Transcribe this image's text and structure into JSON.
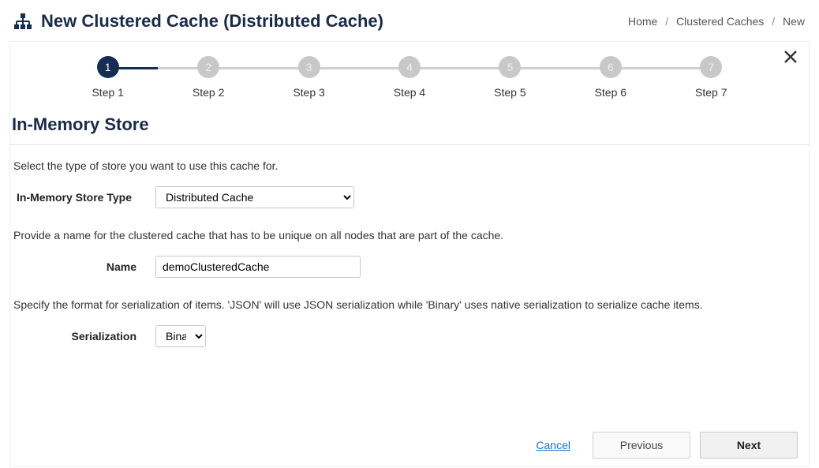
{
  "header": {
    "title": "New Clustered Cache (Distributed Cache)"
  },
  "breadcrumb": {
    "home": "Home",
    "caches": "Clustered Caches",
    "current": "New"
  },
  "stepper": {
    "steps": [
      {
        "num": "1",
        "label": "Step 1"
      },
      {
        "num": "2",
        "label": "Step 2"
      },
      {
        "num": "3",
        "label": "Step 3"
      },
      {
        "num": "4",
        "label": "Step 4"
      },
      {
        "num": "5",
        "label": "Step 5"
      },
      {
        "num": "6",
        "label": "Step 6"
      },
      {
        "num": "7",
        "label": "Step 7"
      }
    ]
  },
  "section": {
    "title": "In-Memory Store",
    "help1": "Select the type of store you want to use this cache for.",
    "help2": "Provide a name for the clustered cache that has to be unique on all nodes that are part of the cache.",
    "help3": "Specify the format for serialization of items. 'JSON' will use JSON serialization while 'Binary' uses native serialization to serialize cache items."
  },
  "form": {
    "store_type_label": "In-Memory Store Type",
    "store_type_value": "Distributed Cache",
    "name_label": "Name",
    "name_value": "demoClusteredCache",
    "serialization_label": "Serialization",
    "serialization_value": "Binary"
  },
  "footer": {
    "cancel": "Cancel",
    "previous": "Previous",
    "next": "Next"
  }
}
